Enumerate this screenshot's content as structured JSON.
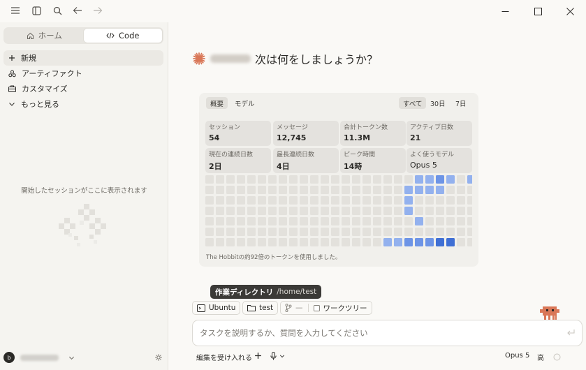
{
  "topbar": {
    "icons": [
      "menu-icon",
      "sidebar-toggle-icon",
      "search-icon",
      "back-arrow-icon",
      "forward-arrow-icon"
    ],
    "window_controls": [
      "minimize-icon",
      "maximize-icon",
      "close-icon"
    ]
  },
  "sidebar": {
    "tabs": [
      {
        "label": "ホーム",
        "icon": "home-icon",
        "active": false
      },
      {
        "label": "Code",
        "icon": "code-icon",
        "active": true
      }
    ],
    "items": [
      {
        "label": "新規",
        "icon": "plus-icon"
      },
      {
        "label": "アーティファクト",
        "icon": "artifacts-icon"
      },
      {
        "label": "カスタマイズ",
        "icon": "briefcase-icon"
      },
      {
        "label": "もっと見る",
        "icon": "chevron-down-icon"
      }
    ],
    "empty_message": "開始したセッションがここに表示されます",
    "user": {
      "avatar_initial": "b"
    }
  },
  "main": {
    "greeting": "次は何をしましょうか？",
    "stats": {
      "tabs_left": [
        "概要",
        "モデル"
      ],
      "tabs_right": [
        "すべて",
        "30日",
        "7日"
      ],
      "cards": [
        {
          "label": "セッション",
          "value": "54"
        },
        {
          "label": "メッセージ",
          "value": "12,745"
        },
        {
          "label": "合計トークン数",
          "value": "11.3M"
        },
        {
          "label": "アクティブ日数",
          "value": "21"
        },
        {
          "label": "現在の連続日数",
          "value": "2日"
        },
        {
          "label": "最長連続日数",
          "value": "4日"
        },
        {
          "label": "ピーク時間",
          "value": "14時"
        },
        {
          "label": "よく使うモデル",
          "value": "Opus 5"
        }
      ],
      "heatmap_levels": [
        [
          0,
          0,
          0,
          0,
          0,
          0,
          0,
          0,
          0,
          0,
          0,
          0,
          0,
          0,
          0,
          0,
          0,
          0,
          0,
          0,
          2,
          2,
          3,
          2,
          0,
          2
        ],
        [
          0,
          0,
          0,
          0,
          0,
          0,
          0,
          0,
          0,
          0,
          0,
          0,
          0,
          0,
          0,
          0,
          0,
          0,
          0,
          2,
          2,
          2,
          2,
          0,
          0,
          0
        ],
        [
          0,
          0,
          0,
          0,
          0,
          0,
          0,
          0,
          0,
          0,
          0,
          0,
          0,
          0,
          0,
          0,
          0,
          0,
          0,
          2,
          0,
          0,
          0,
          0,
          0,
          0
        ],
        [
          0,
          0,
          0,
          0,
          0,
          0,
          0,
          0,
          0,
          0,
          0,
          0,
          0,
          0,
          0,
          0,
          0,
          0,
          0,
          2,
          0,
          0,
          0,
          0,
          0,
          0
        ],
        [
          0,
          0,
          0,
          0,
          0,
          0,
          0,
          0,
          0,
          0,
          0,
          0,
          0,
          0,
          0,
          0,
          0,
          0,
          0,
          0,
          2,
          0,
          0,
          0,
          0,
          0
        ],
        [
          0,
          0,
          0,
          0,
          0,
          0,
          0,
          0,
          0,
          0,
          0,
          0,
          0,
          0,
          0,
          0,
          0,
          0,
          0,
          0,
          0,
          0,
          0,
          0,
          0,
          0
        ],
        [
          0,
          0,
          0,
          0,
          0,
          0,
          0,
          0,
          0,
          0,
          0,
          0,
          0,
          0,
          0,
          0,
          0,
          2,
          2,
          3,
          3,
          3,
          4,
          4,
          0,
          0
        ]
      ],
      "footnote": "The Hobbitの約92倍のトークンを使用しました。"
    },
    "tooltip": {
      "label": "作業ディレクトリ",
      "path": "/home/test"
    },
    "chips": [
      {
        "label": "Ubuntu",
        "icon": "terminal-icon"
      },
      {
        "label": "test",
        "icon": "folder-icon"
      },
      {
        "label": "—",
        "icon": "git-branch-icon"
      },
      {
        "label": "ワークツリー",
        "icon": "checkbox-icon"
      }
    ],
    "composer": {
      "placeholder": "タスクを説明するか、質問を入力してください"
    },
    "bottom": {
      "accept_edits": "編集を受け入れる",
      "model": "Opus 5",
      "effort": "高"
    }
  },
  "colors": {
    "accent": "#d97757",
    "heat_levels": [
      "#e3e1dc",
      "#c3d1f2",
      "#93b1ee",
      "#6d94e6",
      "#3f6fd4"
    ]
  }
}
